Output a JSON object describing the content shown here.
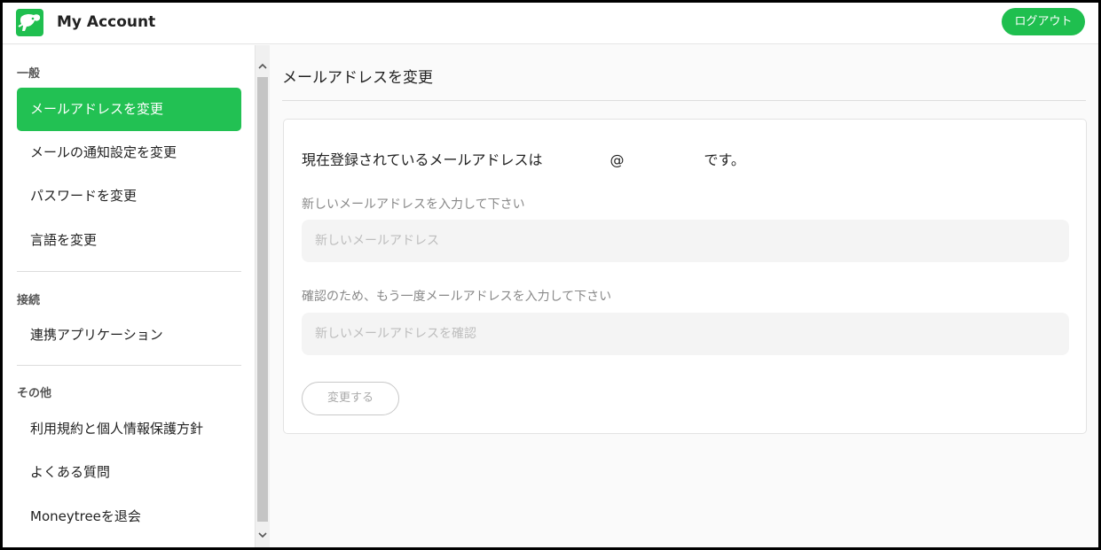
{
  "header": {
    "title": "My Account",
    "logout_label": "ログアウト",
    "brand_color": "#1fbf4f"
  },
  "sidebar": {
    "sections": [
      {
        "label": "一般",
        "items": [
          {
            "label": "メールアドレスを変更",
            "active": true
          },
          {
            "label": "メールの通知設定を変更"
          },
          {
            "label": "パスワードを変更"
          },
          {
            "label": "言語を変更"
          }
        ]
      },
      {
        "label": "接続",
        "items": [
          {
            "label": "連携アプリケーション"
          }
        ]
      },
      {
        "label": "その他",
        "items": [
          {
            "label": "利用規約と個人情報保護方針"
          },
          {
            "label": "よくある質問"
          },
          {
            "label": "Moneytreeを退会"
          }
        ]
      }
    ],
    "active_color": "#22c153"
  },
  "main": {
    "page_title": "メールアドレスを変更",
    "current_email": {
      "prefix": "現在登録されているメールアドレスは",
      "at": "@",
      "suffix": "です。"
    },
    "new_email": {
      "label": "新しいメールアドレスを入力して下さい",
      "placeholder": "新しいメールアドレス",
      "value": ""
    },
    "confirm_email": {
      "label": "確認のため、もう一度メールアドレスを入力して下さい",
      "placeholder": "新しいメールアドレスを確認",
      "value": ""
    },
    "submit_label": "変更する"
  }
}
